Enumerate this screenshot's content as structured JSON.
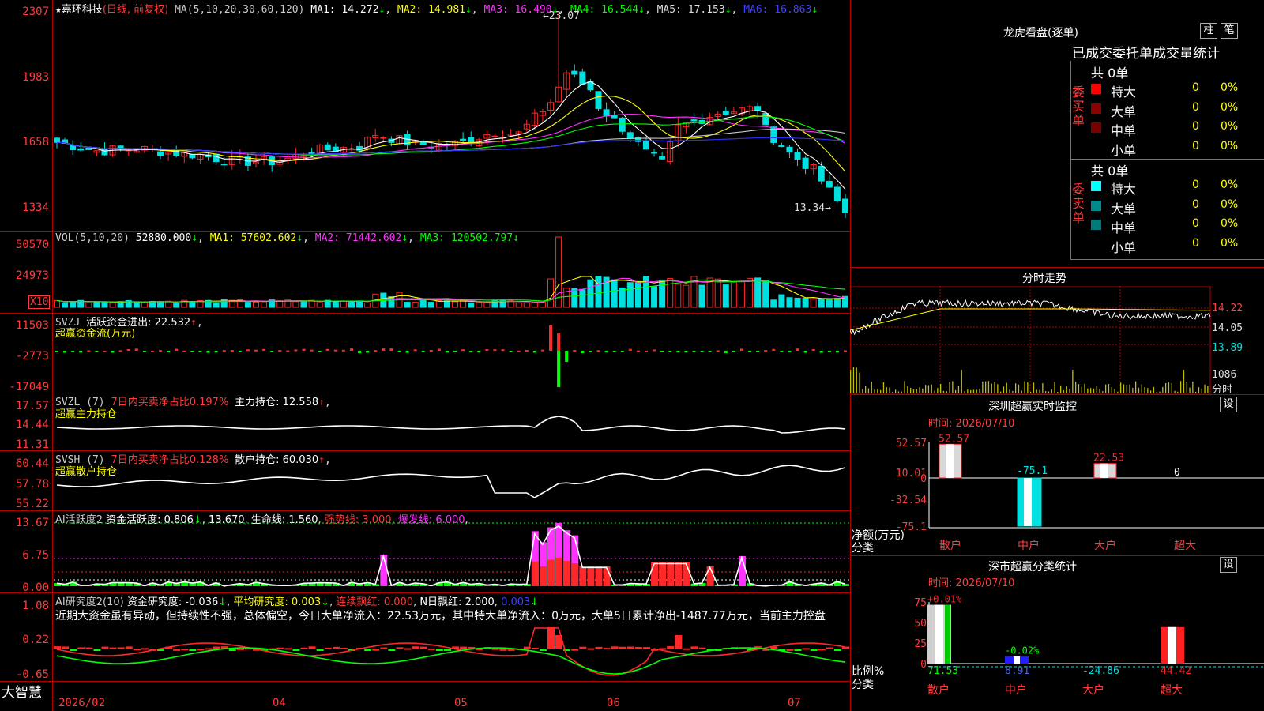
{
  "colors": {
    "up": "#ff2828",
    "down": "#00e0e0",
    "grid": "#b00000",
    "axis": "#ff3b3b",
    "white": "#ffffff",
    "yellow": "#ffff00",
    "magenta": "#ff33ff",
    "green": "#00ff00",
    "blue": "#3030ff",
    "gray": "#c8c8c8"
  },
  "stock": {
    "star": "★",
    "name": "嘉环科技",
    "mode": "(日线, 前复权)",
    "ma_label": "MA(5,10,20,30,60,120)",
    "ma": [
      "MA1: 14.272",
      "MA2: 14.981",
      "MA3: 16.490",
      "MA4: 16.544",
      "MA5: 17.153",
      "MA6: 16.863"
    ],
    "high_mark": "23.07",
    "low_mark": "13.34",
    "axis": [
      "2307",
      "1983",
      "1658",
      "1334"
    ]
  },
  "vol": {
    "label": "VOL(5,10,20)",
    "value": "52880.000",
    "ma": [
      "MA1: 57602.602",
      "MA2: 71442.602",
      "MA3: 120502.797"
    ],
    "axis": [
      "50570",
      "24973",
      "X10"
    ]
  },
  "svzj": {
    "label": "SVZJ",
    "desc": "活跃资金进出: 22.532",
    "sub": "超赢资金流(万元)",
    "axis": [
      "11503",
      "-2773",
      "-17049"
    ]
  },
  "svzl": {
    "label": "SVZL (7)",
    "desc1": "7日内买卖净占比0.197%",
    "desc2": "主力持仓: 12.558",
    "sub": "超赢主力持仓",
    "axis": [
      "17.57",
      "14.44",
      "11.31"
    ]
  },
  "svsh": {
    "label": "SVSH (7)",
    "desc1": "7日内买卖净占比0.128%",
    "desc2": "散户持仓: 60.030",
    "sub": "超赢散户持仓",
    "axis": [
      "60.44",
      "57.78",
      "55.22"
    ]
  },
  "ai1": {
    "label": "AI活跃度2",
    "t1": "资金活跃度: 0.806",
    "t2": "13.670",
    "t3": "生命线: 1.560",
    "t4": "强势线: 3.000",
    "t5": "爆发线: 6.000",
    "axis": [
      "13.67",
      "6.75",
      "0.00"
    ]
  },
  "ai2": {
    "label": "AI研究度2(10)",
    "t1": "资金研究度: -0.036",
    "t2": "平均研究度: 0.003",
    "t3": "连续飘红: 0.000",
    "t4": "N日飘红: 2.000",
    "t5": "0.003",
    "note": "近期大资金虽有异动，但持续性不强，总体偏空，今日大单净流入：22.53万元，其中特大单净流入：0万元，大单5日累计净出-1487.77万元，当前主力控盘",
    "axis": [
      "1.08",
      "0.22",
      "-0.65"
    ]
  },
  "bottom": {
    "brand": "大智慧",
    "dates": [
      "2026/02",
      "04",
      "05",
      "06",
      "07"
    ]
  },
  "right": {
    "longhu": {
      "title": "龙虎看盘(逐单)",
      "btn1": "柱",
      "btn2": "笔",
      "tabs": "已成交委托单成交量统计",
      "buy_label": "委买单",
      "sell_label": "委卖单",
      "buy_total": "共 0单",
      "sell_total": "共 0单",
      "buy_rows": [
        {
          "name": "特大",
          "n": "0",
          "p": "0%",
          "color": "#ff0000"
        },
        {
          "name": "大单",
          "n": "0",
          "p": "0%",
          "color": "#8b0000"
        },
        {
          "name": "中单",
          "n": "0",
          "p": "0%",
          "color": "#7a0000"
        },
        {
          "name": "小单",
          "n": "0",
          "p": "0%",
          "color": "#000000"
        }
      ],
      "sell_rows": [
        {
          "name": "特大",
          "n": "0",
          "p": "0%",
          "color": "#00ffff"
        },
        {
          "name": "大单",
          "n": "0",
          "p": "0%",
          "color": "#008b8b"
        },
        {
          "name": "中单",
          "n": "0",
          "p": "0%",
          "color": "#007a7a"
        },
        {
          "name": "小单",
          "n": "0",
          "p": "0%",
          "color": "#000000"
        }
      ]
    },
    "fenshi": {
      "title": "分时走势",
      "axis": [
        "14.22",
        "14.05",
        "13.89"
      ],
      "vol": "1086",
      "vol_unit": "分时"
    },
    "sz_monitor": {
      "title": "深圳超赢实时监控",
      "btn": "设",
      "time": "时间: 2026/07/10",
      "axis": [
        "52.57",
        "10.01",
        "0",
        "-32.54",
        "-75.1"
      ],
      "ylabel": "净额(万元)",
      "xlabel": "分类",
      "bars": [
        {
          "name": "散户",
          "value": 52.57,
          "label": "52.57"
        },
        {
          "name": "中户",
          "value": -75.1,
          "label": "-75.1"
        },
        {
          "name": "大户",
          "value": 22.53,
          "label": "22.53"
        },
        {
          "name": "超大",
          "value": 0,
          "label": "0"
        }
      ]
    },
    "sz_class": {
      "title": "深市超赢分类统计",
      "btn": "设",
      "time": "时间: 2026/07/10",
      "axis": [
        "75",
        "50",
        "25",
        "0"
      ],
      "ylabel": "比例%",
      "xlabel": "分类",
      "bars": [
        {
          "name": "散户",
          "top": "+0.01%",
          "value": 71.53,
          "label": "71.53"
        },
        {
          "name": "中户",
          "top": "-0.02%",
          "value": 8.91,
          "label": "8.91"
        },
        {
          "name": "大户",
          "top": "",
          "value": -24.86,
          "label": "-24.86"
        },
        {
          "name": "超大",
          "top": "",
          "value": 44.42,
          "label": "44.42"
        }
      ]
    }
  },
  "chart_data": [
    {
      "type": "candlestick",
      "title": "嘉环科技(日线, 前复权)",
      "ylim": [
        13.34,
        23.07
      ],
      "x": [
        "2026/02",
        "04",
        "05",
        "06",
        "07"
      ]
    },
    {
      "type": "bar",
      "title": "超赢资金流(万元)",
      "ylim": [
        -17049,
        11503
      ]
    },
    {
      "type": "bar",
      "title": "深圳超赢实时监控",
      "categories": [
        "散户",
        "中户",
        "大户",
        "超大"
      ],
      "values": [
        52.57,
        -75.1,
        22.53,
        0
      ],
      "ylabel": "净额(万元)",
      "ylim": [
        -75.1,
        52.57
      ]
    },
    {
      "type": "bar",
      "title": "深市超赢分类统计",
      "categories": [
        "散户",
        "中户",
        "大户",
        "超大"
      ],
      "values": [
        71.53,
        8.91,
        -24.86,
        44.42
      ],
      "ylabel": "比例%",
      "ylim": [
        0,
        75
      ]
    }
  ]
}
